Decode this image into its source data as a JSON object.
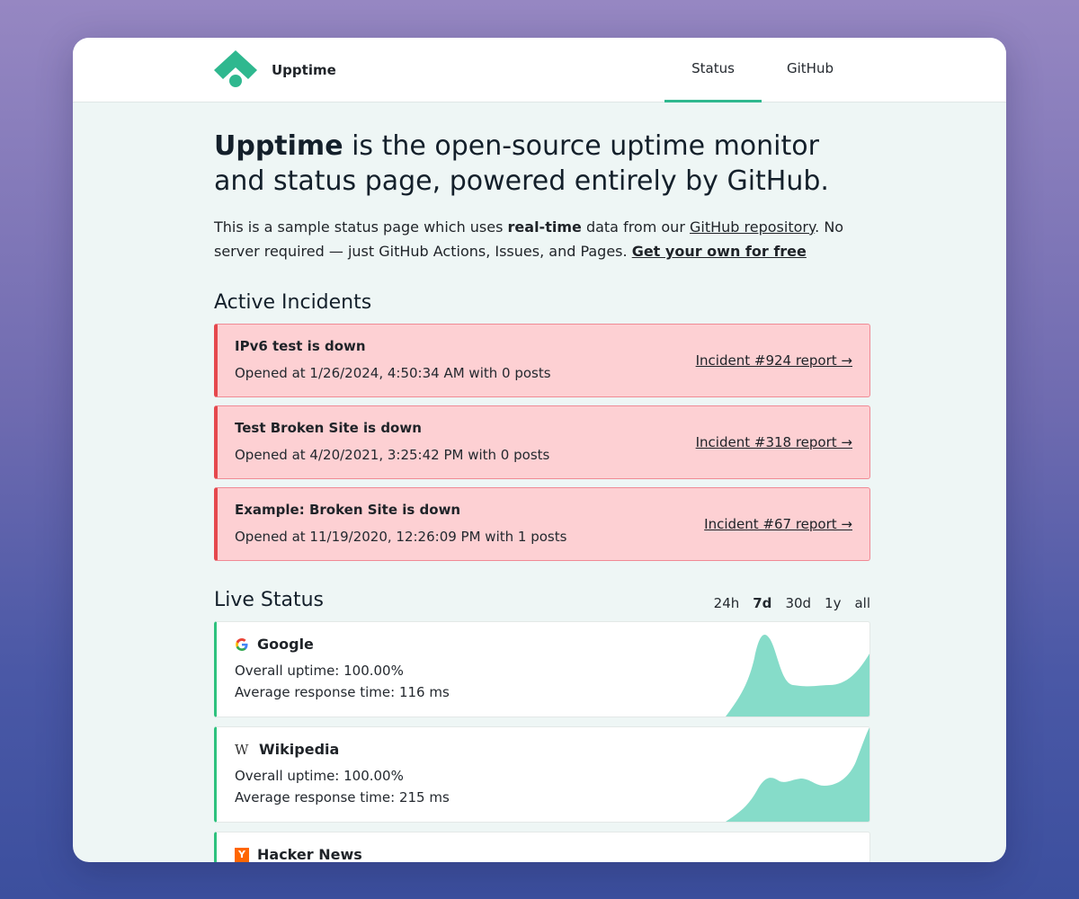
{
  "header": {
    "brand": "Upptime",
    "nav": [
      {
        "label": "Status",
        "active": true
      },
      {
        "label": "GitHub",
        "active": false
      }
    ]
  },
  "hero": {
    "headline_strong": "Upptime",
    "headline_rest": " is the open-source uptime monitor and status page, powered entirely by GitHub.",
    "intro_1": "This is a sample status page which uses ",
    "intro_bold": "real-time",
    "intro_2": " data from our ",
    "intro_link": "GitHub repository",
    "intro_3": ". No server required — just GitHub Actions, Issues, and Pages. ",
    "intro_cta": "Get your own for free"
  },
  "incidents": {
    "title": "Active Incidents",
    "items": [
      {
        "title": "IPv6 test is down",
        "opened": "Opened at 1/26/2024, 4:50:34 AM with 0 posts",
        "link": "Incident #924 report →"
      },
      {
        "title": "Test Broken Site is down",
        "opened": "Opened at 4/20/2021, 3:25:42 PM with 0 posts",
        "link": "Incident #318 report →"
      },
      {
        "title": "Example: Broken Site is down",
        "opened": "Opened at 11/19/2020, 12:26:09 PM with 1 posts",
        "link": "Incident #67 report →"
      }
    ]
  },
  "live": {
    "title": "Live Status",
    "ranges": [
      "24h",
      "7d",
      "30d",
      "1y",
      "all"
    ],
    "selected_range": "7d",
    "sites": [
      {
        "name": "Google",
        "icon": "google-favicon",
        "uptime": "Overall uptime:  100.00%",
        "response": "Average response time:  116 ms"
      },
      {
        "name": "Wikipedia",
        "icon": "wikipedia-favicon",
        "uptime": "Overall uptime:  100.00%",
        "response": "Average response time:  215 ms"
      },
      {
        "name": "Hacker News",
        "icon": "hacker-news-favicon",
        "uptime": "",
        "response": ""
      }
    ]
  },
  "colors": {
    "accent": "#2fb88f",
    "incident_bg": "#fdd0d3",
    "incident_border": "#e5484d",
    "up_border": "#2ec27e",
    "sparkline_fill": "#86dcc9"
  }
}
